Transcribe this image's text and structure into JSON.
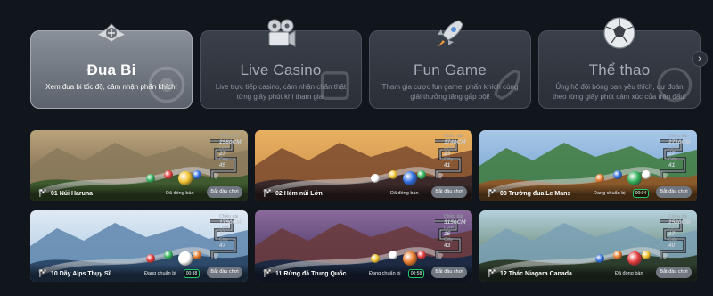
{
  "categories": [
    {
      "title": "Đua Bi",
      "desc": "Xem đua bi tốc độ, cảm nhận phấn khích!",
      "icon": "speed-logo-icon",
      "active": true
    },
    {
      "title": "Live Casino",
      "desc": "Live trực tiếp casino, cảm nhận chân thật từng giây phút khi tham gia!",
      "icon": "camera-icon",
      "active": false
    },
    {
      "title": "Fun Game",
      "desc": "Tham gia cược fun game, phấn khích cùng giải thưởng tăng gấp bội!",
      "icon": "rocket-icon",
      "active": false
    },
    {
      "title": "Thể thao",
      "desc": "Ủng hộ đội bóng bạn yêu thích, dự đoán theo từng giây phút cảm xúc của trận đấu!",
      "icon": "soccer-ball-icon",
      "active": false
    }
  ],
  "next_button": "›",
  "tracks": [
    {
      "name": "01 Núi Haruna",
      "status": "Đã đóng bàn",
      "timer": "",
      "button": "Bắt đầu chơi",
      "stats": [
        "Chiều dài",
        "2980CM",
        "Lượt",
        "27",
        "Giây",
        "45"
      ],
      "accent": "#d98b3a"
    },
    {
      "name": "02 Hẻm núi Lớn",
      "status": "Đã đóng bàn",
      "timer": "",
      "button": "Bắt đầu chơi",
      "stats": [
        "Chiều dài",
        "1740CM",
        "Lượt",
        "23",
        "Giây",
        "41"
      ],
      "accent": "#c96a2e"
    },
    {
      "name": "08 Trường đua Le Mans",
      "status": "Đang chuẩn bị",
      "timer": "00:04",
      "button": "Bắt đầu chơi",
      "stats": [
        "Chiều dài",
        "2710CM",
        "Lượt",
        "17",
        "Giây",
        "41"
      ],
      "accent": "#3a9c4a"
    },
    {
      "name": "10 Dãy Alps Thụy Sĩ",
      "status": "Đang chuẩn bị",
      "timer": "00:38",
      "button": "Bắt đầu chơi",
      "stats": [
        "Chiều dài",
        "1790CM",
        "Lượt",
        "23",
        "Giây",
        "47"
      ],
      "accent": "#5a8fbf"
    },
    {
      "name": "11 Rừng đá Trung Quốc",
      "status": "Đang chuẩn bị",
      "timer": "00:58",
      "button": "Bắt đầu chơi",
      "stats": [
        "Chiều dài",
        "3150CM",
        "Lượt",
        "15",
        "Giây",
        "43"
      ],
      "accent": "#3b4f8a"
    },
    {
      "name": "12 Thác Niagara Canada",
      "status": "Đã đóng bàn",
      "timer": "",
      "button": "Bắt đầu chơi",
      "stats": [
        "Chiều dài",
        "2580CM",
        "Lượt",
        "17",
        "Giây",
        "40"
      ],
      "accent": "#4f8a5a"
    }
  ]
}
